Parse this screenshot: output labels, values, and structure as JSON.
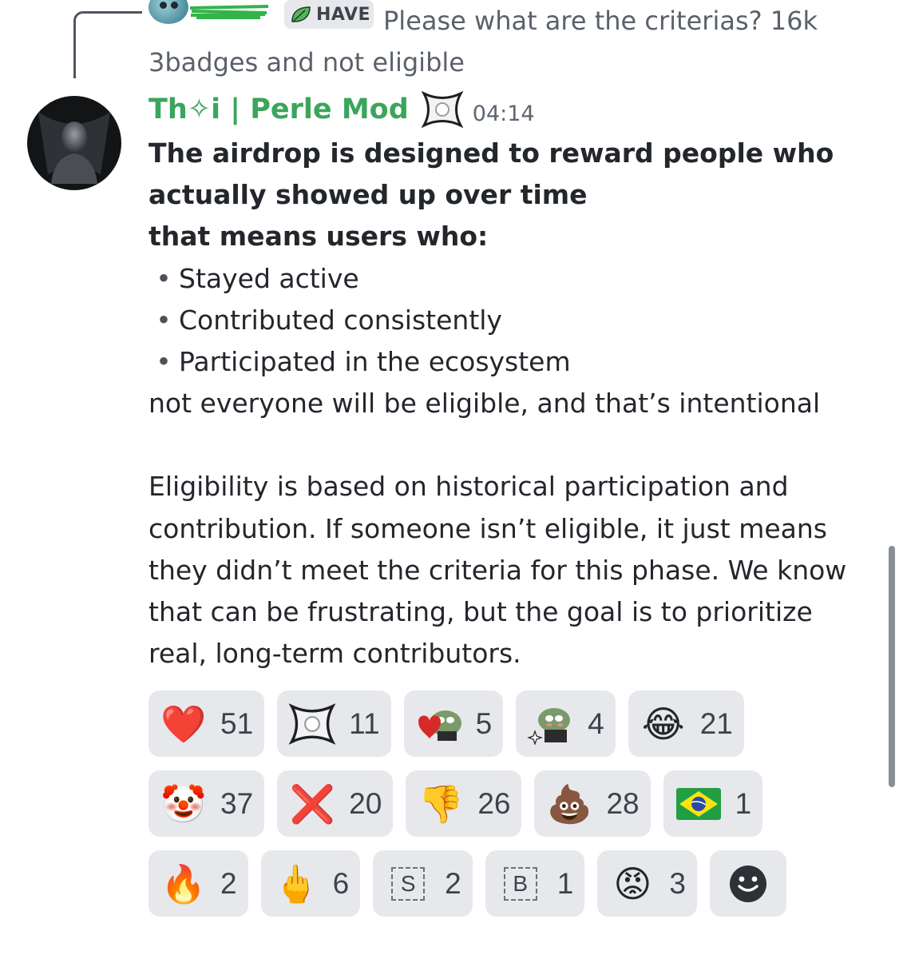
{
  "reply": {
    "role_badge": "HAVE",
    "text": "Please what are the criterias?  16k 3badges and not eligible"
  },
  "message": {
    "author": "Th✧i | Perle Mod",
    "timestamp": "04:14",
    "heading_lines": [
      "The airdrop is designed to reward people who actually showed up over time",
      "that means users who:"
    ],
    "bullets": [
      "Stayed active",
      "Contributed consistently",
      "Participated in the ecosystem"
    ],
    "after_bullets": "not everyone will be eligible, and that’s intentional",
    "paragraph": "Eligibility is based on historical participation and contribution. If someone isn’t eligible, it just means they didn’t meet the criteria for this phase. We know that can be frustrating, but the goal is to prioritize real, long-term contributors."
  },
  "reactions": [
    [
      {
        "icon": "heart-icon",
        "glyph": "❤️",
        "count": "51"
      },
      {
        "icon": "perle-logo-icon",
        "glyph": "",
        "count": "11"
      },
      {
        "icon": "pepe-heart-icon",
        "glyph": "",
        "count": "5"
      },
      {
        "icon": "pepe-sparkle-icon",
        "glyph": "",
        "count": "4"
      },
      {
        "icon": "tears-of-joy-icon",
        "glyph": "😂",
        "count": "21"
      }
    ],
    [
      {
        "icon": "clown-icon",
        "glyph": "🤡",
        "count": "37"
      },
      {
        "icon": "cross-mark-icon",
        "glyph": "❌",
        "count": "20"
      },
      {
        "icon": "thumbs-down-icon",
        "glyph": "👎",
        "count": "26"
      },
      {
        "icon": "poop-icon",
        "glyph": "💩",
        "count": "28"
      },
      {
        "icon": "brazil-flag-icon",
        "glyph": "",
        "count": "1"
      }
    ],
    [
      {
        "icon": "fire-icon",
        "glyph": "🔥",
        "count": "2"
      },
      {
        "icon": "middle-finger-icon",
        "glyph": "🖕",
        "count": "6"
      },
      {
        "icon": "letter-s-icon",
        "glyph": "S",
        "count": "2"
      },
      {
        "icon": "letter-b-icon",
        "glyph": "B",
        "count": "1"
      },
      {
        "icon": "angry-face-icon",
        "glyph": "😡",
        "count": "3"
      }
    ]
  ],
  "colors": {
    "author": "#3ba55c",
    "reaction_bg": "#e7e8ec",
    "text": "#23262b",
    "muted": "#5b616a"
  }
}
